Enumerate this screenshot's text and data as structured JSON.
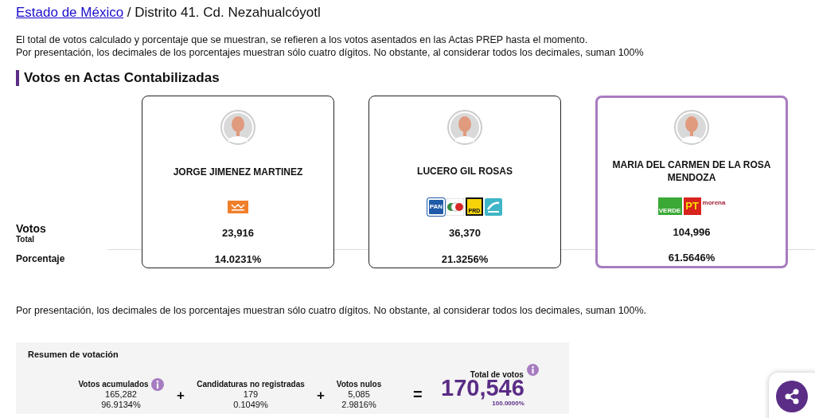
{
  "breadcrumb": {
    "link": "Estado de México",
    "current": "/ Distrito 41. Cd. Nezahualcóyotl"
  },
  "notes": [
    "El total de votos calculado y porcentaje que se muestran, se refieren a los votos asentados en las Actas PREP hasta el momento.",
    "Por presentación, los decimales de los porcentajes muestran sólo cuatro dígitos. No obstante, al considerar todos los decimales, suman 100%"
  ],
  "section_title": "Votos en Actas Contabilizadas",
  "row_labels": {
    "votes": "Votos",
    "votes_sub": "Total",
    "percent": "Porcentaje"
  },
  "candidates": [
    {
      "name": "JORGE JIMENEZ MARTINEZ",
      "votes": "23,916",
      "percent": "14.0231%",
      "selected": false,
      "logos": [
        {
          "kind": "mc"
        }
      ]
    },
    {
      "name": "LUCERO GIL ROSAS",
      "votes": "36,370",
      "percent": "21.3256%",
      "selected": false,
      "logos": [
        {
          "kind": "pan",
          "label": "PAN"
        },
        {
          "kind": "pri"
        },
        {
          "kind": "prd",
          "label": "PRD"
        },
        {
          "kind": "alianza"
        }
      ]
    },
    {
      "name": "MARIA DEL CARMEN DE LA ROSA MENDOZA",
      "votes": "104,996",
      "percent": "61.5646%",
      "selected": true,
      "logos": [
        {
          "kind": "verde",
          "label": "VERDE"
        },
        {
          "kind": "pt",
          "label": "PT"
        },
        {
          "kind": "morena",
          "label": "morena"
        }
      ]
    }
  ],
  "footnote": "Por presentación, los decimales de los porcentajes muestran sólo cuatro dígitos. No obstante, al considerar todos los decimales, suman 100%.",
  "summary": {
    "title": "Resumen de votación",
    "items": [
      {
        "label": "Votos acumulados",
        "value": "165,282",
        "percent": "96.9134%",
        "info": true
      },
      {
        "operator": "+",
        "label": "Candidaturas no registradas",
        "value": "179",
        "percent": "0.1049%",
        "info": false
      },
      {
        "operator": "+",
        "label": "Votos nulos",
        "value": "5,085",
        "percent": "2.9816%",
        "info": false
      }
    ],
    "total": {
      "operator": "=",
      "label": "Total de votos",
      "value": "170,546",
      "percent": "100.0000%",
      "info": true
    }
  }
}
